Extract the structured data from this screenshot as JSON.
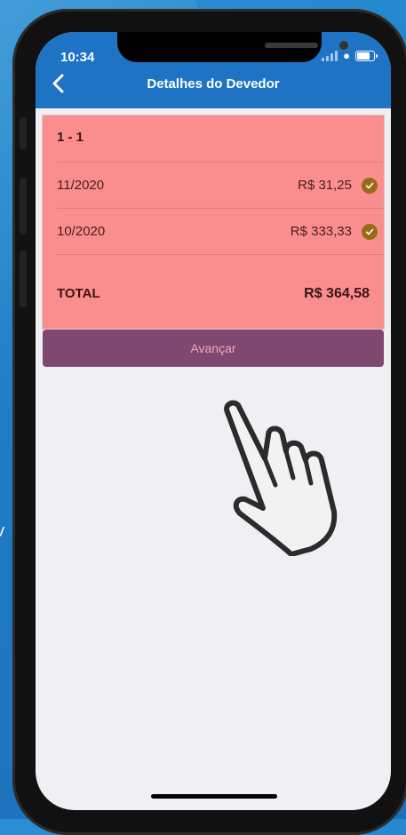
{
  "status_bar": {
    "time": "10:34"
  },
  "header": {
    "title": "Detalhes do Devedor",
    "back_icon": "chevron-left-icon"
  },
  "card": {
    "heading": "1 - 1",
    "rows": [
      {
        "period": "11/2020",
        "amount": "R$ 31,25",
        "status_icon": "check-circle-icon"
      },
      {
        "period": "10/2020",
        "amount": "R$ 333,33",
        "status_icon": "check-circle-icon"
      }
    ],
    "total_label": "TOTAL",
    "total_amount": "R$ 364,58"
  },
  "advance_button": {
    "label": "Avançar"
  },
  "colors": {
    "app_bar": "#1e73c4",
    "card_background": "#fa8e8e",
    "button_background": "#7e4870",
    "check_badge": "#9a6b16"
  }
}
